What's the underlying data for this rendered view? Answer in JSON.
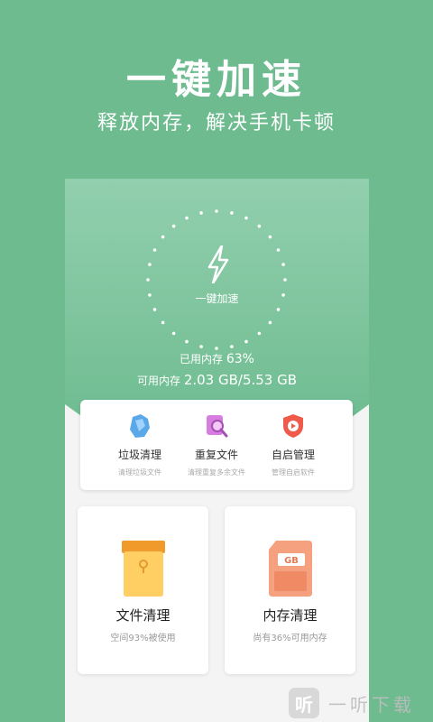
{
  "hero": {
    "title": "一键加速",
    "subtitle": "释放内存，解决手机卡顿"
  },
  "booster": {
    "button_label": "一键加速",
    "used_label": "已用内存",
    "used_value": "63%",
    "avail_label": "可用内存",
    "avail_value": "2.03 GB/5.53 GB"
  },
  "tools": [
    {
      "name": "垃圾清理",
      "desc": "清理垃圾文件",
      "icon": "trash-cleanup-icon"
    },
    {
      "name": "重复文件",
      "desc": "清理重复多余文件",
      "icon": "duplicate-file-search-icon"
    },
    {
      "name": "自启管理",
      "desc": "管理自启软件",
      "icon": "autostart-shield-icon"
    }
  ],
  "cards": {
    "file": {
      "title": "文件清理",
      "sub": "空间93%被使用",
      "icon": "folder-envelope-icon"
    },
    "memory": {
      "title": "内存清理",
      "sub": "尚有36%可用内存",
      "icon": "memory-card-icon",
      "chip_text": "GB"
    }
  },
  "watermark": {
    "logo_char": "听",
    "text": "一听下载"
  },
  "colors": {
    "brand_green": "#6dbb8f",
    "light_green": "#92cfae"
  }
}
